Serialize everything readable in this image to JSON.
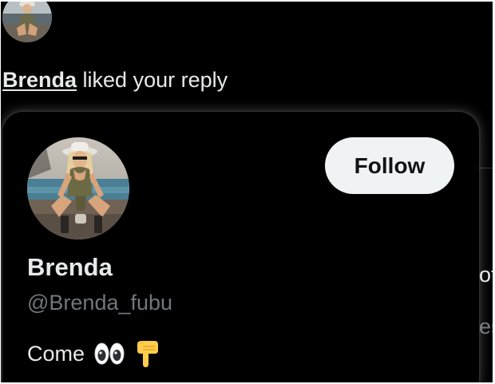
{
  "notification": {
    "user_name": "Brenda",
    "action_text": " liked your reply",
    "avatar_icon": "user-avatar-photo"
  },
  "hover_card": {
    "display_name": "Brenda",
    "handle": "@Brenda_fubu",
    "bio_text": "Come",
    "bio_emojis": [
      "eyes-emoji",
      "pointing-down-emoji"
    ],
    "follow_label": "Follow",
    "avatar_icon": "profile-avatar-photo"
  },
  "background": {
    "partial_text_1": "ot",
    "partial_text_2": "es"
  },
  "colors": {
    "background": "#000000",
    "primary_text": "#e7e9ea",
    "secondary_text": "#71767b",
    "follow_button_bg": "#eff3f4",
    "follow_button_text": "#0f1419"
  }
}
